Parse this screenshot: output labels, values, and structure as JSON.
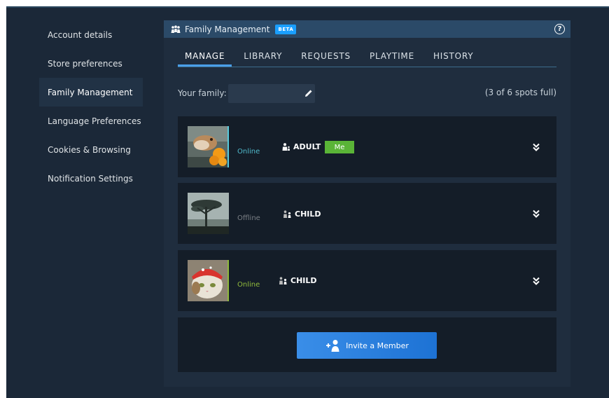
{
  "sidebar": {
    "items": [
      {
        "label": "Account details"
      },
      {
        "label": "Store preferences"
      },
      {
        "label": "Family Management"
      },
      {
        "label": "Language Preferences"
      },
      {
        "label": "Cookies & Browsing"
      },
      {
        "label": "Notification Settings"
      }
    ],
    "active_index": 2
  },
  "panel": {
    "title": "Family Management",
    "badge": "BETA",
    "help_icon": "question-circle-icon",
    "help_glyph": "?"
  },
  "tabs": [
    {
      "label": "MANAGE",
      "active": true
    },
    {
      "label": "LIBRARY",
      "active": false
    },
    {
      "label": "REQUESTS",
      "active": false
    },
    {
      "label": "PLAYTIME",
      "active": false
    },
    {
      "label": "HISTORY",
      "active": false
    }
  ],
  "family": {
    "label": "Your family:",
    "name_value": "",
    "spots": "(3 of 6 spots full)"
  },
  "members": [
    {
      "status": "Online",
      "role": "ADULT",
      "badge": "Me",
      "avatar": "hamster-photo"
    },
    {
      "status": "Offline",
      "role": "CHILD",
      "badge": "",
      "avatar": "tree-photo"
    },
    {
      "status": "Online",
      "role": "CHILD",
      "badge": "",
      "avatar": "cat-bandana-photo"
    }
  ],
  "invite": {
    "label": "Invite a Member",
    "icon": "add-user-icon"
  },
  "colors": {
    "background": "#1b2838",
    "panel": "#1f2d3e",
    "header": "#2b4a68",
    "accent": "#1a9fff",
    "online": "#57cbde",
    "in_game": "#90ba3c",
    "me_badge": "#5ab437"
  }
}
